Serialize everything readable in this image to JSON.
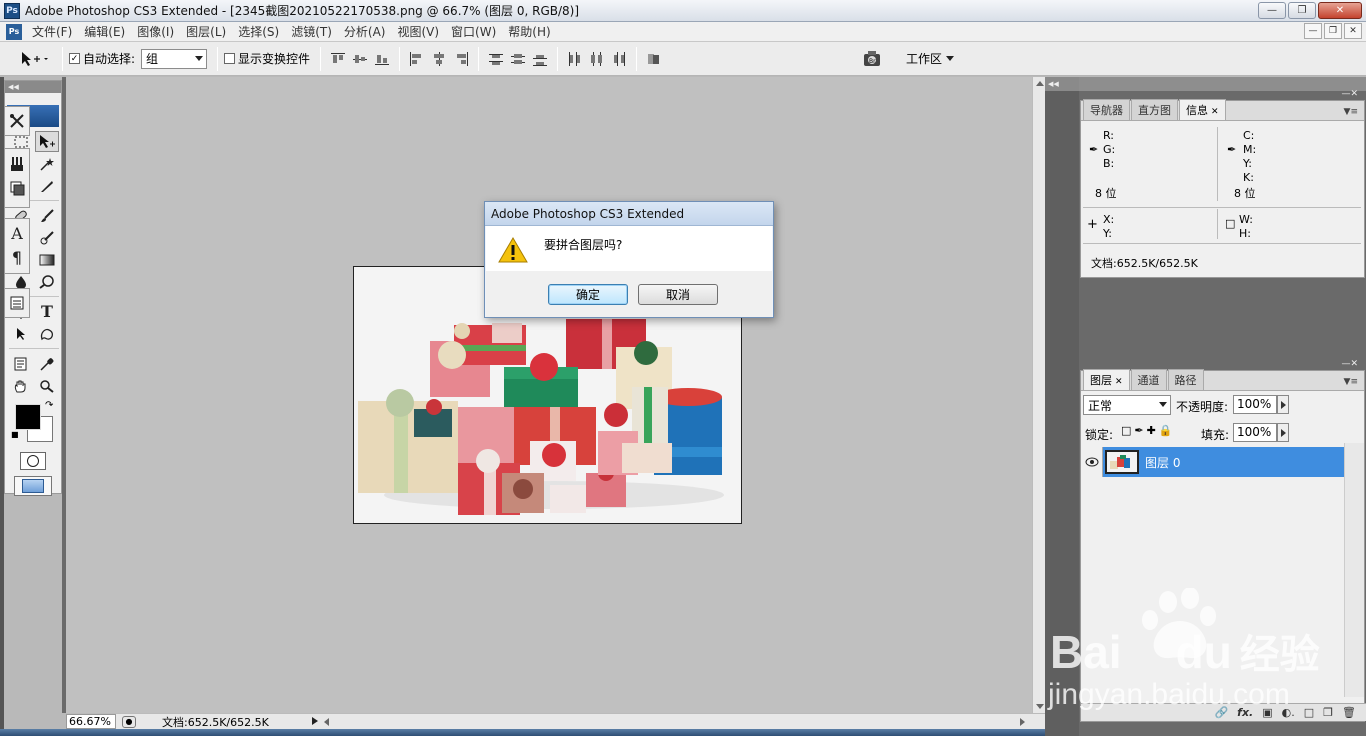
{
  "app": {
    "title": "Adobe Photoshop CS3 Extended - [2345截图20210522170538.png @ 66.7% (图层 0, RGB/8)]",
    "logo": "Ps"
  },
  "menu": [
    "文件(F)",
    "编辑(E)",
    "图像(I)",
    "图层(L)",
    "选择(S)",
    "滤镜(T)",
    "分析(A)",
    "视图(V)",
    "窗口(W)",
    "帮助(H)"
  ],
  "options": {
    "auto_select_label": "自动选择:",
    "auto_select_checked": true,
    "auto_select_value": "组",
    "show_transform_label": "显示变换控件",
    "show_transform_checked": false,
    "workspace_label": "工作区"
  },
  "status": {
    "zoom": "66.67%",
    "doc": "文档:652.5K/652.5K"
  },
  "panels": {
    "top_tabs": [
      {
        "label": "导航器",
        "active": false
      },
      {
        "label": "直方图",
        "active": false
      },
      {
        "label": "信息",
        "active": true,
        "closable": true
      }
    ],
    "info": {
      "r": "R:",
      "g": "G:",
      "b": "B:",
      "c": "C:",
      "m": "M:",
      "y": "Y:",
      "k": "K:",
      "bits_left": "8 位",
      "bits_right": "8 位",
      "x": "X:",
      "y2": "Y:",
      "w": "W:",
      "h": "H:",
      "doc": "文档:652.5K/652.5K"
    },
    "layer_tabs": [
      {
        "label": "图层",
        "active": true,
        "closable": true
      },
      {
        "label": "通道",
        "active": false
      },
      {
        "label": "路径",
        "active": false
      }
    ],
    "layers": {
      "blend_mode": "正常",
      "opacity_label": "不透明度:",
      "opacity": "100%",
      "lock_label": "锁定:",
      "fill_label": "填充:",
      "fill": "100%",
      "items": [
        {
          "name": "图层 0",
          "selected": true,
          "visible": true
        }
      ]
    }
  },
  "dialog": {
    "title": "Adobe Photoshop CS3 Extended",
    "message": "要拼合图层吗?",
    "ok": "确定",
    "cancel": "取消"
  },
  "watermark": {
    "brand": "Bai",
    "brand2": "du",
    "suffix": "经验",
    "url": "jingyan.baidu.com"
  },
  "colors": {
    "accent": "#3f8ddf",
    "foreground": "#000000",
    "background": "#ffffff"
  }
}
